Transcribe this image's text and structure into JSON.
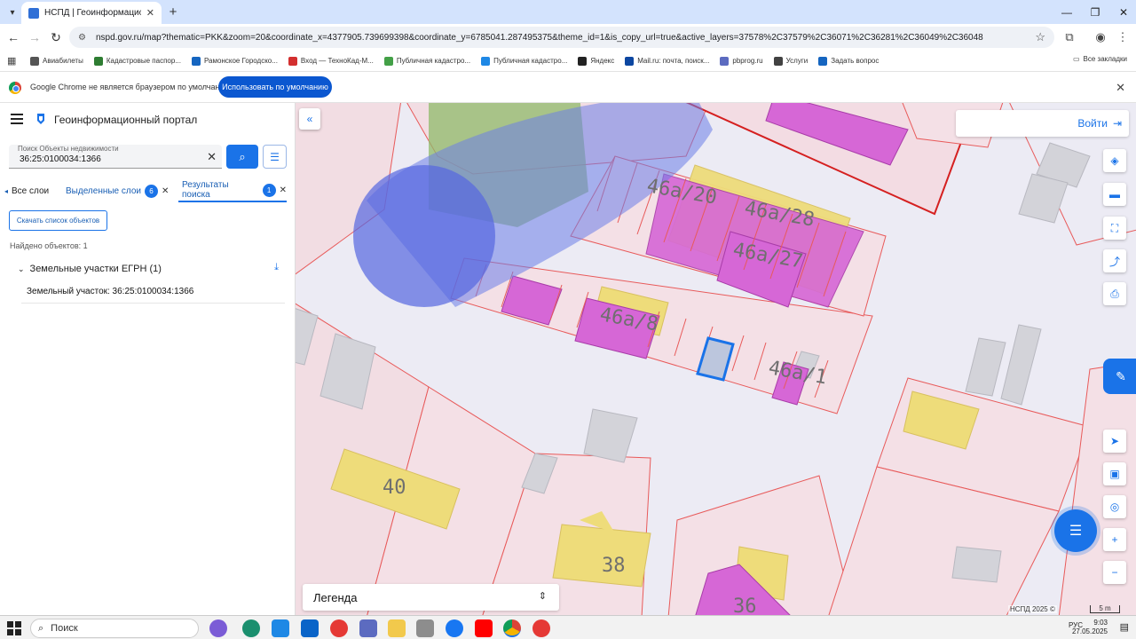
{
  "browser": {
    "tab_title": "НСПД | Геоинформационный по...",
    "url": "nspd.gov.ru/map?thematic=PKK&zoom=20&coordinate_x=4377905.739699398&coordinate_y=6785041.287495375&theme_id=1&is_copy_url=true&active_layers=37578%2C37579%2C36071%2C36281%2C36049%2C36048",
    "bookmarks": [
      {
        "label": "Авиабилеты",
        "color": "#555555"
      },
      {
        "label": "Кадастровые паспор...",
        "color": "#2e7d32"
      },
      {
        "label": "Рамонское Городско...",
        "color": "#1565c0"
      },
      {
        "label": "Вход — ТехноКад-М...",
        "color": "#d32f2f"
      },
      {
        "label": "Публичная кадастро...",
        "color": "#43a047"
      },
      {
        "label": "Публичная кадастро...",
        "color": "#1e88e5"
      },
      {
        "label": "Яндекс",
        "color": "#222222"
      },
      {
        "label": "Mail.ru: почта, поиск...",
        "color": "#0d47a1"
      },
      {
        "label": "pbprog.ru",
        "color": "#5c6bc0"
      },
      {
        "label": "Услуги",
        "color": "#424242"
      },
      {
        "label": "Задать вопрос",
        "color": "#1565c0"
      }
    ],
    "bookmarks_all": "Все закладки",
    "infobar_message": "Google Chrome не является браузером по умолчанию.",
    "infobar_button": "Использовать по умолчанию"
  },
  "panel": {
    "title": "Геоинформационный портал",
    "search_label": "Поиск Объекты недвижимости",
    "search_value": "36:25:0100034:1366",
    "tabs": [
      {
        "label": "Все слои"
      },
      {
        "label": "Выделенные слои",
        "badge": "6"
      },
      {
        "label": "Результаты поиска",
        "badge": "1"
      }
    ],
    "download_button": "Скачать список объектов",
    "found_text": "Найдено объектов: 1",
    "group_label": "Земельные участки ЕГРН (1)",
    "item_label": "Земельный участок: 36:25:0100034:1366"
  },
  "map": {
    "login_label": "Войти",
    "legend_label": "Легенда",
    "copyright": "НСПД 2025 ©",
    "scale": "5 m",
    "parcel_labels": [
      "46а/20",
      "46а/28",
      "46а/27",
      "46а/8",
      "46а/1",
      "40",
      "38",
      "36"
    ]
  },
  "taskbar": {
    "search_placeholder": "Поиск",
    "lang": "РУС",
    "time": "9:03",
    "date": "27.05.2025"
  }
}
